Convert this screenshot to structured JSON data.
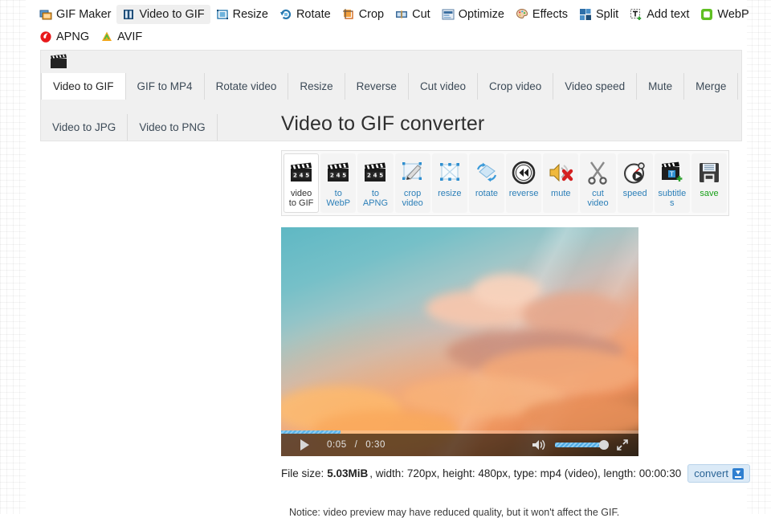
{
  "topnav": {
    "items": [
      {
        "label": "GIF Maker",
        "icon": "gif-maker-icon",
        "active": false
      },
      {
        "label": "Video to GIF",
        "icon": "video-to-gif-icon",
        "active": true
      },
      {
        "label": "Resize",
        "icon": "resize-icon",
        "active": false
      },
      {
        "label": "Rotate",
        "icon": "rotate-icon",
        "active": false
      },
      {
        "label": "Crop",
        "icon": "crop-icon",
        "active": false
      },
      {
        "label": "Cut",
        "icon": "cut-icon",
        "active": false
      },
      {
        "label": "Optimize",
        "icon": "optimize-icon",
        "active": false
      },
      {
        "label": "Effects",
        "icon": "effects-icon",
        "active": false
      },
      {
        "label": "Split",
        "icon": "split-icon",
        "active": false
      },
      {
        "label": "Add text",
        "icon": "add-text-icon",
        "active": false
      },
      {
        "label": "WebP",
        "icon": "webp-icon",
        "active": false
      }
    ],
    "items_row2": [
      {
        "label": "APNG",
        "icon": "apng-icon",
        "active": false
      },
      {
        "label": "AVIF",
        "icon": "avif-icon",
        "active": false
      }
    ]
  },
  "tabs": {
    "logo_icon": "clapperboard-icon",
    "row1": [
      {
        "label": "Video to GIF",
        "active": true
      },
      {
        "label": "GIF to MP4",
        "active": false
      },
      {
        "label": "Rotate video",
        "active": false
      },
      {
        "label": "Resize",
        "active": false
      },
      {
        "label": "Reverse",
        "active": false
      },
      {
        "label": "Cut video",
        "active": false
      },
      {
        "label": "Crop video",
        "active": false
      },
      {
        "label": "Video speed",
        "active": false
      },
      {
        "label": "Mute",
        "active": false
      },
      {
        "label": "Merge",
        "active": false
      }
    ],
    "row2": [
      {
        "label": "Video to JPG",
        "active": false
      },
      {
        "label": "Video to PNG",
        "active": false
      }
    ]
  },
  "main": {
    "title": "Video to GIF converter",
    "toolbar": [
      {
        "label": "video to GIF",
        "icon": "clapperboard-icon",
        "active": true,
        "color": "default"
      },
      {
        "label": "to WebP",
        "icon": "clapperboard-icon",
        "active": false,
        "color": "blue"
      },
      {
        "label": "to APNG",
        "icon": "clapperboard-icon",
        "active": false,
        "color": "blue"
      },
      {
        "label": "crop video",
        "icon": "crop-pen-icon",
        "active": false,
        "color": "blue"
      },
      {
        "label": "resize",
        "icon": "resize-box-icon",
        "active": false,
        "color": "blue"
      },
      {
        "label": "rotate",
        "icon": "rotate-arrows-icon",
        "active": false,
        "color": "blue"
      },
      {
        "label": "reverse",
        "icon": "rewind-icon",
        "active": false,
        "color": "blue"
      },
      {
        "label": "mute",
        "icon": "mute-speaker-icon",
        "active": false,
        "color": "blue"
      },
      {
        "label": "cut video",
        "icon": "scissors-icon",
        "active": false,
        "color": "blue"
      },
      {
        "label": "speed",
        "icon": "stopwatch-icon",
        "active": false,
        "color": "blue"
      },
      {
        "label": "subtitles",
        "icon": "subtitles-icon",
        "active": false,
        "color": "blue"
      },
      {
        "label": "save",
        "icon": "floppy-save-icon",
        "active": false,
        "color": "green"
      }
    ],
    "player": {
      "play_icon": "play-icon",
      "current_time": "0:05",
      "separator": "/",
      "duration": "0:30",
      "progress_percent": 16.6,
      "volume_icon": "volume-icon",
      "volume_percent": 100,
      "fullscreen_icon": "fullscreen-icon"
    },
    "file_info": {
      "size_label": "File size:",
      "size_value": "5.03MiB",
      "rest": ", width: 720px, height: 480px, type: mp4 (video), length: 00:00:30",
      "convert_label": "convert",
      "convert_icon": "download-icon"
    },
    "notice": "Notice: video preview may have reduced quality, but it won't affect the GIF."
  },
  "colors": {
    "accent_blue": "#2c7fb8",
    "save_green": "#18a018",
    "convert_bg": "#dbeaf7"
  }
}
